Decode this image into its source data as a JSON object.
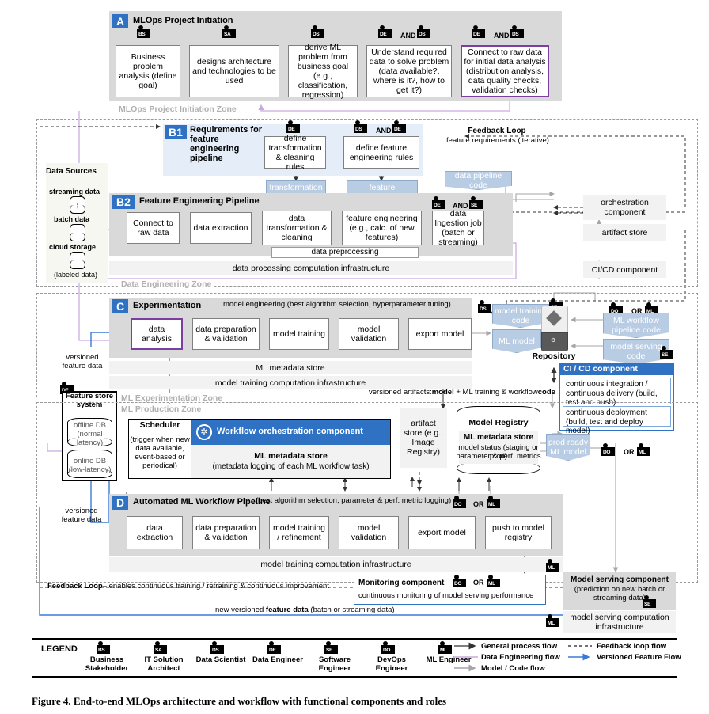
{
  "figure": {
    "caption": "Figure 4. End-to-end MLOps architecture and workflow with functional components and roles"
  },
  "sectionA": {
    "badge": "A",
    "title": "MLOps Project Initiation",
    "zone_label": "MLOps Project Initiation Zone",
    "steps": [
      {
        "text": "Business problem analysis (define goal)",
        "role": "BSP"
      },
      {
        "text": "designs architecture and technologies to be used",
        "role": "SA"
      },
      {
        "text": "derive ML problem from business goal (e.g., classification, regression)",
        "role": "DSI"
      },
      {
        "text": "Understand required data to solve problem (data available?, where is it?, how to get it?)",
        "role": "DE AND DSI"
      },
      {
        "text": "Connect to raw data for initial data analysis (distribution analysis, data quality checks, validation checks)",
        "role": "DE AND DSI"
      }
    ],
    "and_label": "AND"
  },
  "dataSources": {
    "title": "Data Sources",
    "items": [
      "streaming data",
      "batch data",
      "cloud storage"
    ],
    "note": "(labeled data)"
  },
  "sectionB1": {
    "badge": "B1",
    "title": "Requirements for feature engineering pipeline",
    "boxes": [
      {
        "text": "define transformation & cleaning rules",
        "role": "DE"
      },
      {
        "text": "define feature engineering rules",
        "role": "DSI AND DE"
      }
    ],
    "and_label": "AND",
    "feedback_title": "Feedback Loop",
    "feedback_sub": "feature requirements (iterative)"
  },
  "sectionB2": {
    "badge": "B2",
    "title": "Feature Engineering Pipeline",
    "boxes": [
      {
        "text": "Connect to raw data"
      },
      {
        "text": "data extraction"
      },
      {
        "text": "data transformation & cleaning"
      },
      {
        "text": "feature engineering (e.g., calc. of new features)"
      },
      {
        "text": "data Ingestion job (batch or streaming)",
        "role": "DE AND SE"
      }
    ],
    "and_label": "AND",
    "preprocessing": "data preprocessing",
    "infrastructure": "data processing computation infrastructure",
    "zone_label": "Data Engineering Zone",
    "artifacts": [
      "transformation rules",
      "feature engineering rules",
      "data pipeline code"
    ]
  },
  "sectionC": {
    "badge": "C",
    "title": "Experimentation",
    "subtitle": "model engineering (best algorithm selection, hyperparameter tuning)",
    "boxes": [
      {
        "text": "data analysis",
        "highlight": true
      },
      {
        "text": "data preparation & validation"
      },
      {
        "text": "model training"
      },
      {
        "text": "model validation"
      },
      {
        "text": "export model"
      }
    ],
    "metadata_store": "ML metadata store",
    "infrastructure": "model training computation infrastructure",
    "zone_label": "ML Experimentation Zone",
    "artifacts": [
      "model training code",
      "ML model"
    ],
    "role_ds": "DSI",
    "role_se": "SE"
  },
  "featureStore": {
    "title": "Feature store system",
    "offline": "offline DB (normal latency)",
    "online": "online DB (low-latency)",
    "label_top": "versioned feature data",
    "label_bottom": "versioned feature data",
    "role": "DE"
  },
  "rightColumn": {
    "orchestration": "orchestration component",
    "artifact_store": "artifact store",
    "cicd": "CI/CD component"
  },
  "repository": {
    "label": "Repository",
    "inputs": [
      "ML workflow pipeline code",
      "model serving code"
    ],
    "versioned_artifacts_prefix": "versioned artifacts:",
    "versioned_artifacts_bold1": "model",
    "versioned_artifacts_mid": " + ML training & workflow",
    "versioned_artifacts_bold2": "code",
    "or_label": "OR"
  },
  "cicdComponent": {
    "title": "CI / CD component",
    "line1": "continuous integration / continuous delivery (build, test and push)",
    "line2": "continuous deployment (build, test and deploy model)"
  },
  "production": {
    "zone_label": "ML Production Zone",
    "scheduler_title": "Scheduler",
    "scheduler_body": "(trigger when new data available, event-based or periodical)",
    "orchestration_title": "Workflow orchestration component",
    "metadata_title": "ML metadata store",
    "metadata_sub": "(metadata logging of each ML workflow task)",
    "artifact_store": "artifact store (e.g., Image Registry)",
    "model_registry_title": "Model Registry",
    "model_registry_sub1": "ML metadata store",
    "model_registry_sub2": "model status (staging or prod)",
    "model_registry_sub3": "parameter & perf. metrics",
    "prod_model": "prod ready ML model",
    "or_label": "OR"
  },
  "sectionD": {
    "badge": "D",
    "title": "Automated ML Workflow Pipeline",
    "subtitle": "(best algorithm selection, parameter & perf. metric logging)",
    "or_label": "OR",
    "boxes": [
      {
        "text": "data extraction"
      },
      {
        "text": "data preparation & validation"
      },
      {
        "text": "model training / refinement"
      },
      {
        "text": "model validation"
      },
      {
        "text": "export model"
      },
      {
        "text": "push to model registry"
      }
    ],
    "infrastructure": "model training computation infrastructure"
  },
  "bottom": {
    "feedback_bold": "Feedback Loop",
    "feedback_rest": "– enables continuous training / retraining & continuous improvement",
    "new_versioned_pre": "new versioned ",
    "new_versioned_bold": "feature data",
    "new_versioned_post": " (batch or streaming data)",
    "monitoring_title": "Monitoring component",
    "monitoring_or": "OR",
    "monitoring_sub": "continuous monitoring of model serving performance",
    "serving_title": "Model serving component",
    "serving_sub": "(prediction on new batch or streaming data)",
    "serving_infra": "model serving computation infrastructure"
  },
  "legend": {
    "title": "LEGEND",
    "roles": [
      {
        "name": "Business Stakeholder",
        "code": "BSP"
      },
      {
        "name": "IT Solution Architect",
        "code": "SA"
      },
      {
        "name": "Data Scientist",
        "code": "DSI"
      },
      {
        "name": "Data Engineer",
        "code": "DE"
      },
      {
        "name": "Software Engineer",
        "code": "SE"
      },
      {
        "name": "DevOps Engineer",
        "code": "DO"
      },
      {
        "name": "ML Engineer",
        "code": "ML"
      }
    ],
    "flows": [
      {
        "label": "General process flow",
        "color": "#555555"
      },
      {
        "label": "Data Engineering flow",
        "color": "#c9a8e0"
      },
      {
        "label": "Model / Code flow",
        "color": "#a6a6a6"
      },
      {
        "label": "Feedback loop flow",
        "color": "#444444"
      },
      {
        "label": "Versioned Feature Flow",
        "color": "#3a7ad6"
      }
    ]
  },
  "colors": {
    "accent_blue": "#2f72c4",
    "artifact_blue": "#b8cce4",
    "gray_band": "#d9d9d9",
    "light_band": "#f2f2f2",
    "panel_blue": "#e4edf8",
    "purple": "#7b3fa0",
    "feature_flow": "#3a7ad6"
  }
}
